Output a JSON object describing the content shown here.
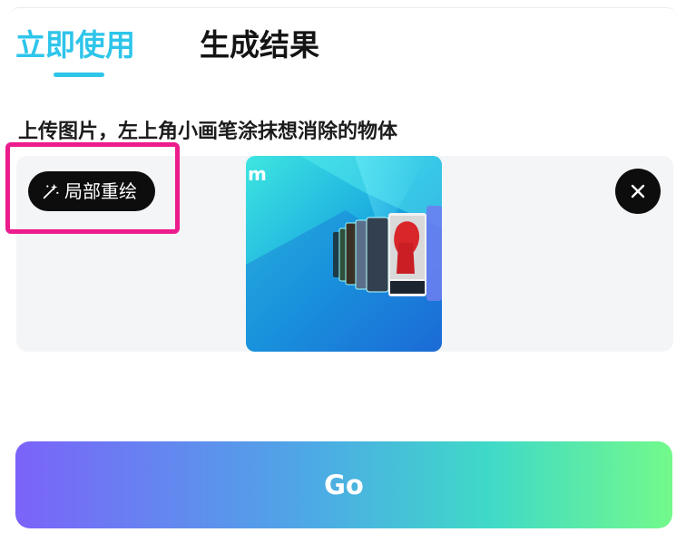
{
  "tabs": {
    "active_label": "立即使用",
    "inactive_label": "生成结果"
  },
  "instruction": "上传图片，左上角小画笔涂抹想消除的物体",
  "upload": {
    "inpaint_button_label": "局部重绘",
    "preview_logo_letter": "m",
    "wand_icon": "magic-wand-icon",
    "close_icon": "close-icon"
  },
  "go_button_label": "Go",
  "colors": {
    "accent": "#2ec5ea",
    "highlight": "#ec1c8d",
    "go_gradient_start": "#7b63f9",
    "go_gradient_end": "#73f98b"
  }
}
